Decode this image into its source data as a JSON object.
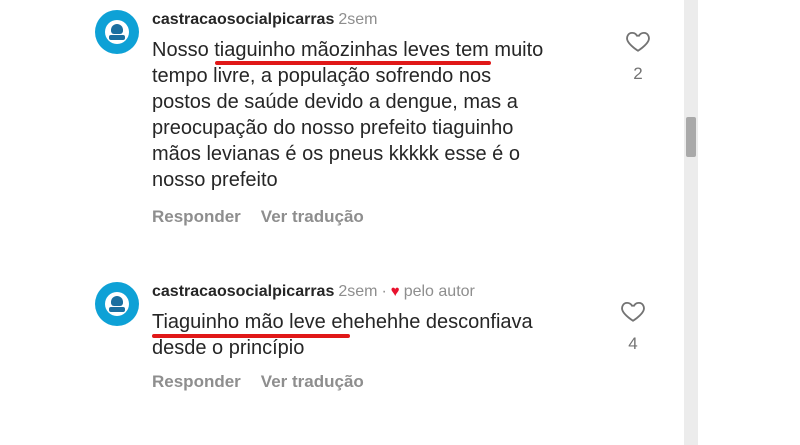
{
  "comments": [
    {
      "username": "castracaosocialpicarras",
      "time": "2sem",
      "author_badge": "",
      "text_lines": [
        "Nosso tiaguinho mãozinhas leves tem muito",
        "tempo livre, a população sofrendo nos",
        "postos de saúde devido a dengue, mas a",
        "preocupação do nosso prefeito tiaguinho",
        "mãos levianas é os pneus kkkkk esse é o",
        "nosso prefeito"
      ],
      "reply_label": "Responder",
      "translate_label": "Ver tradução",
      "likes": "2"
    },
    {
      "username": "castracaosocialpicarras",
      "time": "2sem",
      "separator": "·",
      "author_badge": "pelo autor",
      "text_lines": [
        "Tiaguinho mão leve ehehehhe desconfiava",
        "desde o princípio"
      ],
      "reply_label": "Responder",
      "translate_label": "Ver tradução",
      "likes": "4"
    }
  ],
  "colors": {
    "avatar": "#0ea1d6",
    "underline": "#e01818",
    "heart": "#e8112d",
    "muted": "#8e8e8e"
  },
  "icons": [
    "heart-outline-icon",
    "heart-filled-icon",
    "avatar-logo-icon"
  ]
}
